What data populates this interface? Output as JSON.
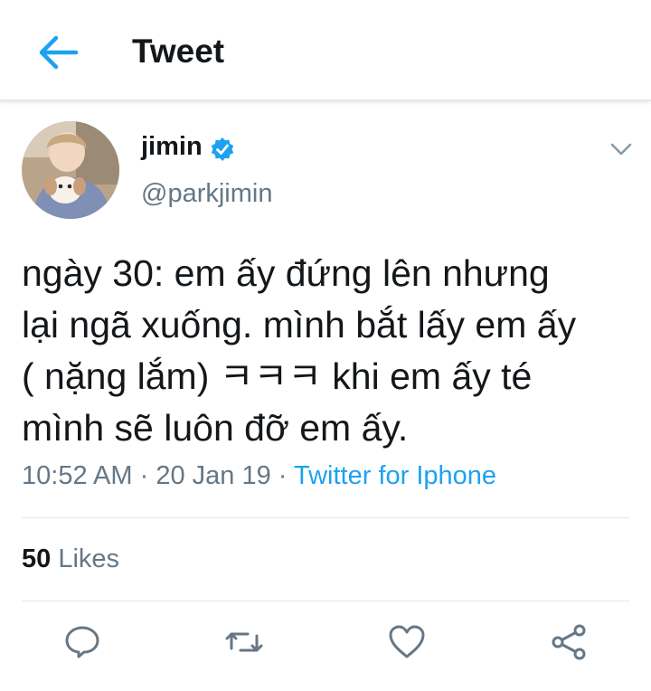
{
  "header": {
    "title": "Tweet",
    "back_icon": "arrow-left-icon",
    "accent_color": "#1da1f2"
  },
  "author": {
    "display_name": "jimin",
    "handle": "@parkjimin",
    "verified_icon": "verified-badge-icon",
    "avatar": "avatar-photo",
    "menu_icon": "chevron-down-icon"
  },
  "tweet": {
    "text": "ngày 30: em ấy đứng lên nhưng\nlại ngã xuống. mình bắt lấy em ấy\n( nặng lắm) ㅋㅋㅋ khi em ấy té\nmình sẽ luôn đỡ em ấy.",
    "time": "10:52 AM",
    "separator": "·",
    "date": "20 Jan 19",
    "source": "Twitter for Iphone"
  },
  "stats": {
    "likes_count": "50",
    "likes_label": "Likes"
  },
  "actions": [
    {
      "name": "reply",
      "icon": "reply-icon"
    },
    {
      "name": "retweet",
      "icon": "retweet-icon"
    },
    {
      "name": "like",
      "icon": "heart-icon"
    },
    {
      "name": "share",
      "icon": "share-icon"
    }
  ]
}
